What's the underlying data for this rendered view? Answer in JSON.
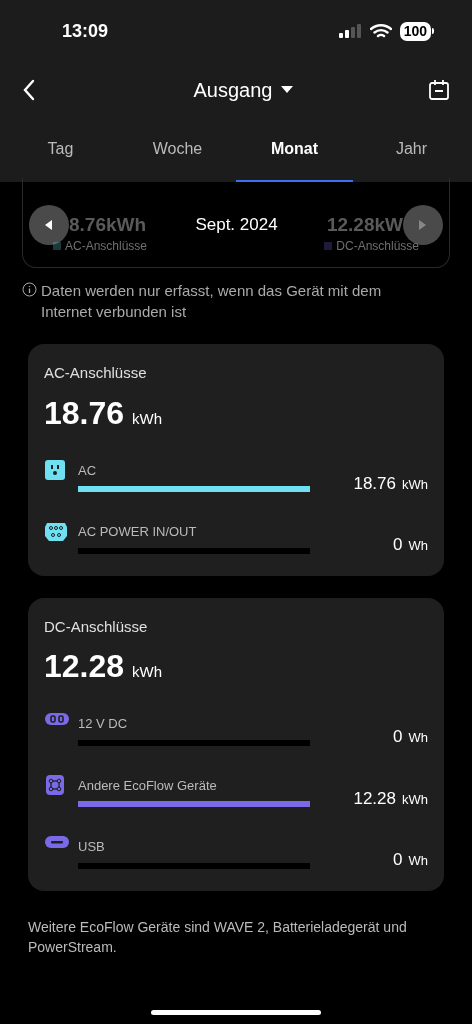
{
  "status_bar": {
    "time": "13:09",
    "battery": "100"
  },
  "header": {
    "title": "Ausgang"
  },
  "tabs": [
    {
      "label": "Tag",
      "selected": false
    },
    {
      "label": "Woche",
      "selected": false
    },
    {
      "label": "Monat",
      "selected": true
    },
    {
      "label": "Jahr",
      "selected": false
    }
  ],
  "summary": {
    "period": "Sept. 2024",
    "ac_value": "8.76kWh",
    "dc_value": "12.28kW",
    "ac_legend": "AC-Anschlüsse",
    "dc_legend": "DC-Anschlüsse"
  },
  "notice": "Daten werden nur erfasst, wenn das Gerät mit dem Internet verbunden ist",
  "groups": [
    {
      "title": "AC-Anschlüsse",
      "total": "18.76",
      "unit": "kWh",
      "color": "#6ee0f2",
      "ports": [
        {
          "kind": "outlet",
          "name": "AC",
          "level": 1,
          "value": "18.76",
          "unit": "kWh"
        },
        {
          "kind": "ac-power",
          "name": "AC POWER IN/OUT",
          "level": 0,
          "value": "0",
          "unit": "Wh"
        }
      ]
    },
    {
      "title": "DC-Anschlüsse",
      "total": "12.28",
      "unit": "kWh",
      "color": "#7b6ae8",
      "ports": [
        {
          "kind": "dc-12v",
          "name": "12 V DC",
          "level": 0,
          "value": "0",
          "unit": "Wh"
        },
        {
          "kind": "ecoflow",
          "name": "Andere EcoFlow Geräte",
          "level": 1,
          "value": "12.28",
          "unit": "kWh"
        },
        {
          "kind": "usb",
          "name": "USB",
          "level": 0,
          "value": "0",
          "unit": "Wh"
        }
      ]
    }
  ],
  "footer": "Weitere EcoFlow Geräte sind WAVE 2, Batterieladegerät und PowerStream."
}
